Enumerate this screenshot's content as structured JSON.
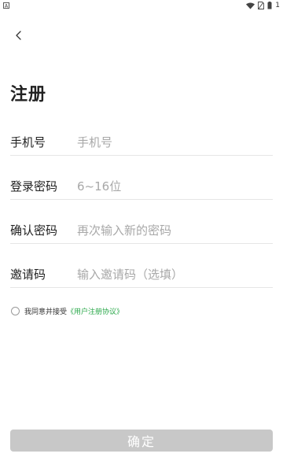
{
  "status_bar": {
    "left_icon": "a-notification-icon",
    "right_icons": [
      "wifi-icon",
      "no-sim-icon"
    ],
    "battery_text": "1"
  },
  "header": {
    "back_icon": "chevron-left-icon",
    "title": "注册"
  },
  "form": {
    "phone": {
      "label": "手机号",
      "placeholder": "手机号"
    },
    "password": {
      "label": "登录密码",
      "placeholder": "6~16位"
    },
    "confirm_password": {
      "label": "确认密码",
      "placeholder": "再次输入新的密码"
    },
    "invite_code": {
      "label": "邀请码",
      "placeholder": "输入邀请码（选填）"
    }
  },
  "agreement": {
    "text": "我同意并接受",
    "link_text": "《用户注册协议》",
    "link_color": "#2aa84a",
    "checked": false
  },
  "submit": {
    "label": "确定",
    "background": "#c8c8c8"
  }
}
